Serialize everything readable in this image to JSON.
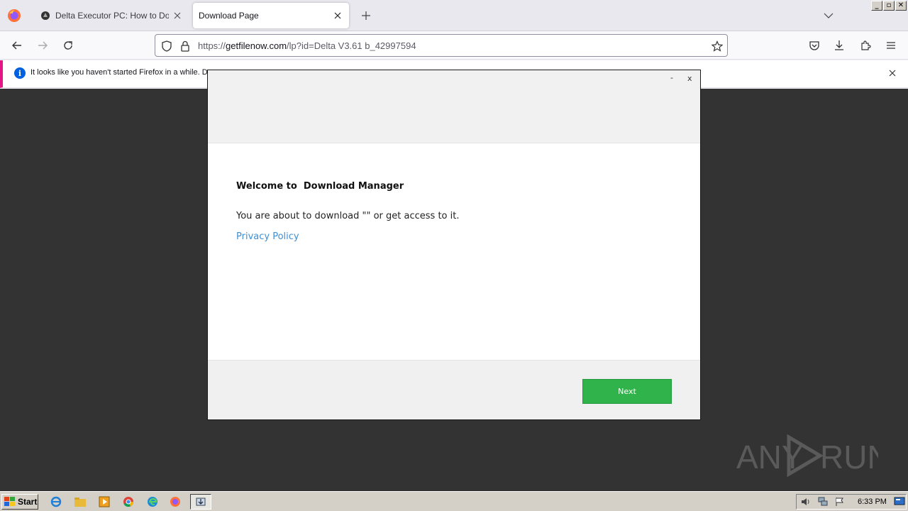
{
  "browser": {
    "tabs": [
      {
        "title": "Delta Executor PC: How to Download",
        "active": false
      },
      {
        "title": "Download Page",
        "active": true
      }
    ],
    "url": {
      "scheme": "https://",
      "host": "getfilenow.com",
      "path": "/lp?id=Delta V3.61 b_42997594"
    },
    "notification": "It looks like you haven't started Firefox in a while. D"
  },
  "dialog": {
    "minimize_label": "-",
    "close_label": "x",
    "title": "Welcome to  Download Manager",
    "message": "You are about to download \"\" or get access to it.",
    "privacy_link": "Privacy Policy",
    "next_label": "Next"
  },
  "watermark": {
    "text_left": "ANY",
    "text_right": "RUN"
  },
  "taskbar": {
    "start_label": "Start",
    "clock": "6:33 PM"
  },
  "colors": {
    "accent_green": "#2fb34a",
    "link_blue": "#3d8fd6",
    "page_background": "#333333",
    "notification_accent": "#e31587"
  }
}
